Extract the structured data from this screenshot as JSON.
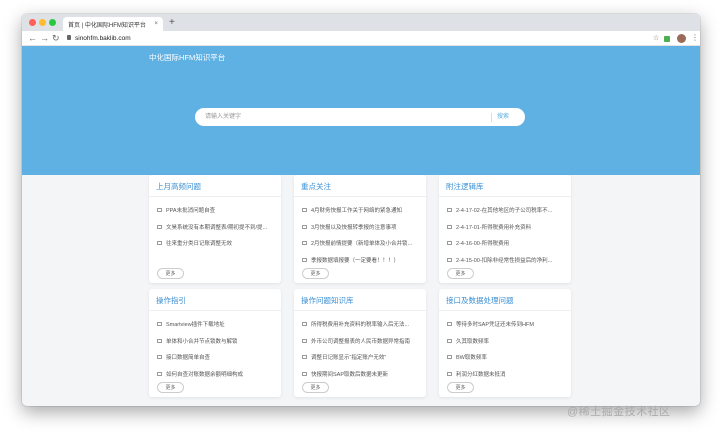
{
  "browser": {
    "tab_title": "首页 | 中化国际HFM知识平台",
    "tab_close": "×",
    "new_tab": "+",
    "url": "sinohfm.baklib.com",
    "nav": {
      "back": "←",
      "forward": "→",
      "reload": "↻"
    },
    "toolbar_icons": {
      "star": "☆",
      "menu": "⋮"
    }
  },
  "site": {
    "title": "中化国际HFM知识平台",
    "hero_color": "#5fb0e3",
    "accent_color": "#3a8fd4"
  },
  "search": {
    "placeholder": "请输入关键字",
    "button": "搜索"
  },
  "more_label": "更多",
  "cards": [
    {
      "title": "上月高频问题",
      "items": [
        "PPA未批消问题自查",
        "文昊系统没有本期调整表/期初提不到/提...",
        "往来重分类日记账调整无效"
      ]
    },
    {
      "title": "重点关注",
      "items": [
        "4月财务快报工作关于网络的紧急通知",
        "3月快报以及快报转季报的注意事项",
        "2月快报前情提要（新增单体及小合并锁...",
        "季报数据填报要（一定要看！！！）"
      ]
    },
    {
      "title": "附注逻辑库",
      "items": [
        "2-4-17-02-在其他地区的子公司税率不...",
        "2-4-17-01-所得税费用补充资料",
        "2-4-16-00-所得税费用",
        "2-4-15-00-扣除非经常性损益后的净利..."
      ]
    },
    {
      "title": "操作指引",
      "items": [
        "Smartview插件下载地址",
        "单体和小合并节点锁数与解锁",
        "接口数据简单自查",
        "如何自查对账数据余额明细构成"
      ]
    },
    {
      "title": "操作问题知识库",
      "items": [
        "所得税费用补充资料的税率输入后无法...",
        "外币公司调整报表的人民币数据异常指南",
        "调整日记账显示“指定账户无效”",
        "快报期间SAP取数后数据未更新"
      ]
    },
    {
      "title": "接口及数据处理问题",
      "items": [
        "等待多时SAP凭证还未传到HFM",
        "久其取数频率",
        "BW取数频率",
        "利润分红数据未抵消"
      ]
    }
  ],
  "watermark": "@稀土掘金技术社区"
}
